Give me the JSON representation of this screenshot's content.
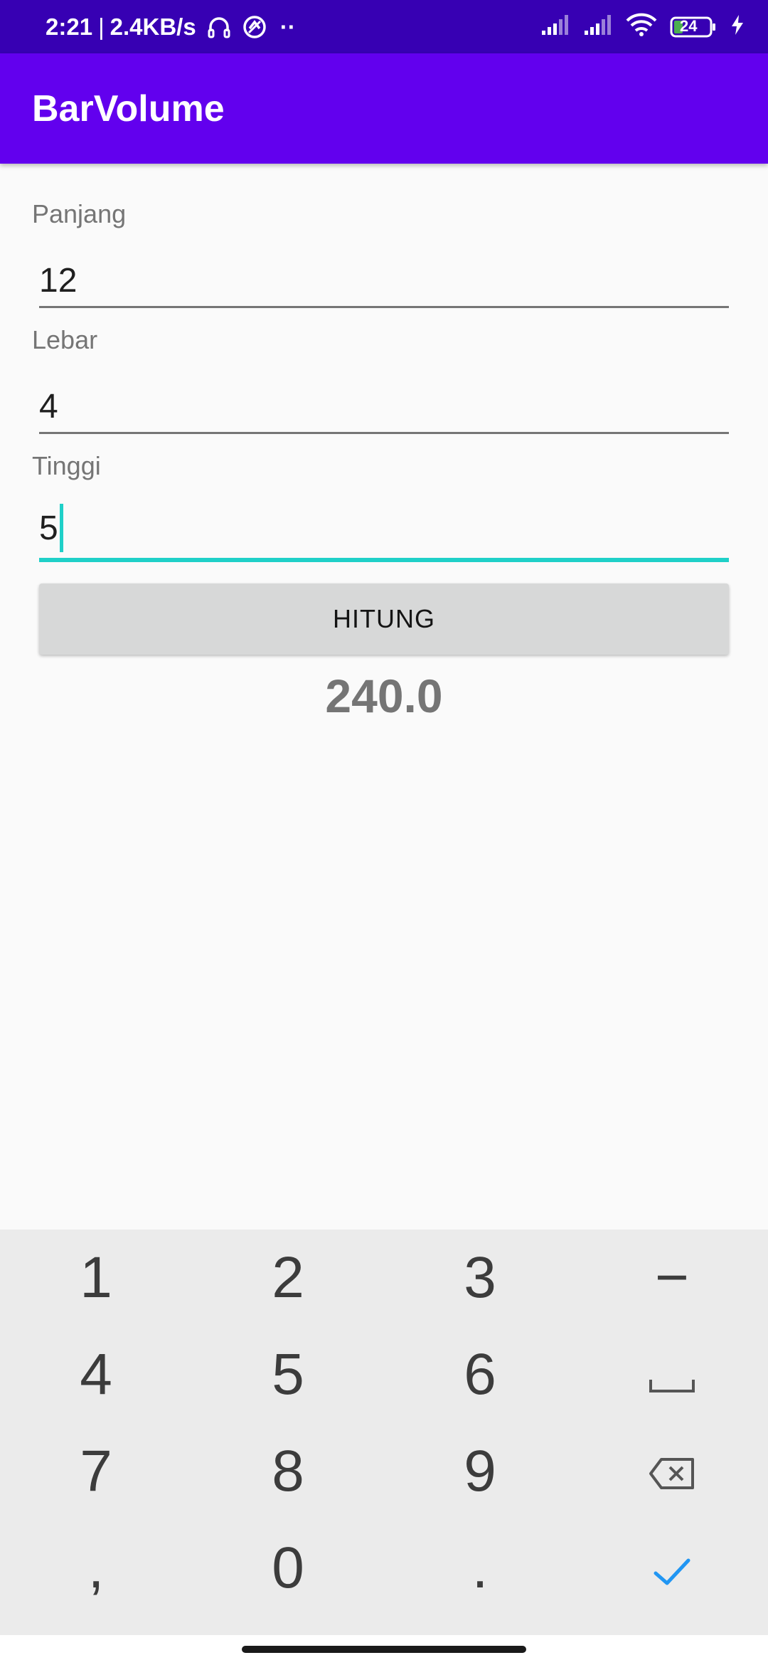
{
  "status_bar": {
    "time": "2:21",
    "separator": "|",
    "net_speed": "2.4KB/s",
    "dots": "··",
    "battery_level": "24",
    "icons": [
      "headphones-icon",
      "sync-icon",
      "signal-icon",
      "signal-icon",
      "wifi-icon",
      "battery-icon",
      "charging-icon"
    ]
  },
  "app_bar": {
    "title": "BarVolume",
    "color": "#6200ee"
  },
  "form": {
    "panjang": {
      "label": "Panjang",
      "value": "12"
    },
    "lebar": {
      "label": "Lebar",
      "value": "4"
    },
    "tinggi": {
      "label": "Tinggi",
      "value": "5"
    },
    "accent_color": "#1fd0c8"
  },
  "button": {
    "label": "HITUNG"
  },
  "result": {
    "value": "240.0"
  },
  "keyboard": {
    "keys": [
      "1",
      "2",
      "3",
      "−",
      "4",
      "5",
      "6",
      "space-icon",
      "7",
      "8",
      "9",
      "backspace-icon",
      ",",
      "0",
      ".",
      "check-icon"
    ],
    "k1": "1",
    "k2": "2",
    "k3": "3",
    "kminus": "−",
    "k4": "4",
    "k5": "5",
    "k6": "6",
    "k7": "7",
    "k8": "8",
    "k9": "9",
    "kcomma": ",",
    "k0": "0",
    "kdot": "."
  }
}
